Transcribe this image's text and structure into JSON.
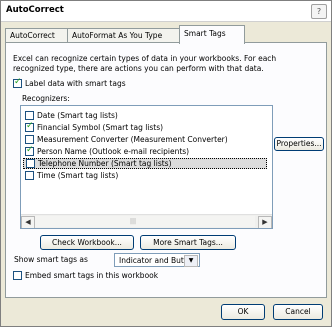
{
  "window": {
    "title": "AutoCorrect",
    "help_glyph": "?"
  },
  "tabs": [
    {
      "label": "AutoCorrect"
    },
    {
      "label": "AutoFormat As You Type"
    },
    {
      "label": "Smart Tags"
    }
  ],
  "panel": {
    "description": "Excel can recognize certain types of data in your workbooks. For each recognized type, there are actions you can perform with that data.",
    "label_checkbox": {
      "text": "Label data with smart tags",
      "checked": true
    },
    "recognizers_label": "Recognizers:",
    "recognizers": [
      {
        "label": "Date (Smart tag lists)",
        "checked": false
      },
      {
        "label": "Financial Symbol (Smart tag lists)",
        "checked": true
      },
      {
        "label": "Measurement Converter (Measurement Converter)",
        "checked": false
      },
      {
        "label": "Person Name (Outlook e-mail recipients)",
        "checked": true
      },
      {
        "label": "Telephone Number (Smart tag lists)",
        "checked": false,
        "selected": true
      },
      {
        "label": "Time (Smart tag lists)",
        "checked": false
      }
    ],
    "properties_button": "Properties...",
    "check_workbook_button": "Check Workbook...",
    "more_smart_tags_button": "More Smart Tags...",
    "show_as_label": "Show smart tags as",
    "show_as_value": "Indicator and Button",
    "embed_checkbox": {
      "text": "Embed smart tags in this workbook",
      "checked": false
    }
  },
  "footer": {
    "ok": "OK",
    "cancel": "Cancel"
  }
}
